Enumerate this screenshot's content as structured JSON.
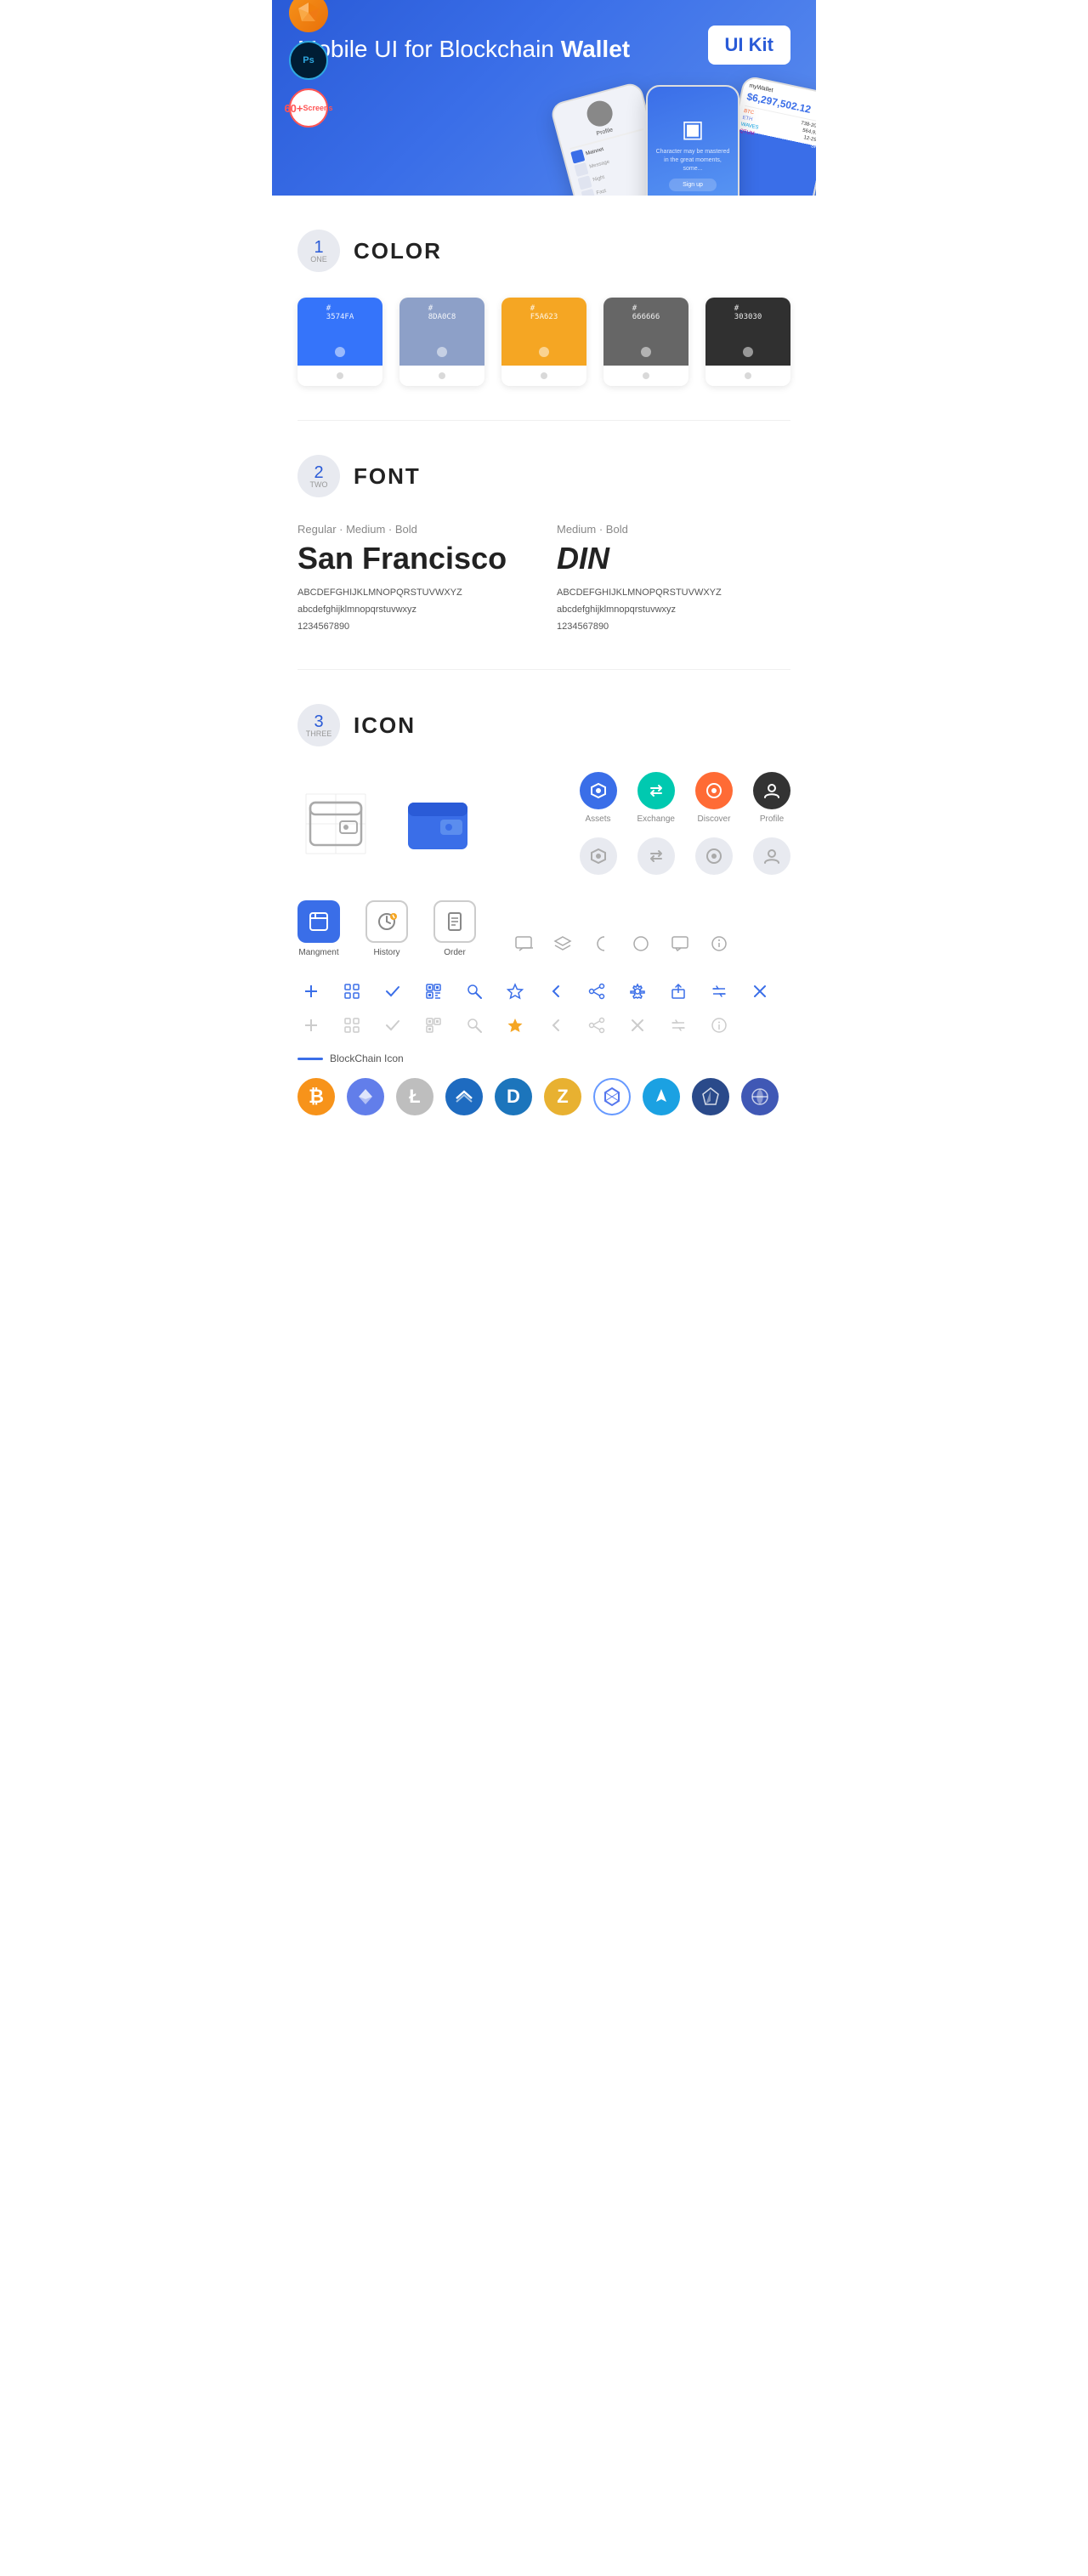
{
  "hero": {
    "title_plain": "Mobile UI for Blockchain ",
    "title_bold": "Wallet",
    "badge": "UI Kit",
    "tool_sketch": "S",
    "tool_ps": "Ps",
    "screens_count": "60+",
    "screens_label": "Screens"
  },
  "sections": {
    "color": {
      "number": "1",
      "word": "ONE",
      "title": "COLOR",
      "swatches": [
        {
          "hex": "#3574FA",
          "label": "#\n3574FA",
          "bg": "#3574FA"
        },
        {
          "hex": "#8DA0C8",
          "label": "#\n8DA0C8",
          "bg": "#8DA0C8"
        },
        {
          "hex": "#F5A623",
          "label": "#\nF5A623",
          "bg": "#F5A623"
        },
        {
          "hex": "#666666",
          "label": "#\n666666",
          "bg": "#666666"
        },
        {
          "hex": "#303030",
          "label": "#\n303030",
          "bg": "#303030"
        }
      ]
    },
    "font": {
      "number": "2",
      "word": "TWO",
      "title": "FONT",
      "font1": {
        "style": "Regular · Medium · Bold",
        "name": "San Francisco",
        "upper": "ABCDEFGHIJKLMNOPQRSTUVWXYZ",
        "lower": "abcdefghijklmnopqrstuvwxyz",
        "nums": "1234567890"
      },
      "font2": {
        "style": "Medium · Bold",
        "name": "DIN",
        "upper": "ABCDEFGHIJKLMNOPQRSTUVWXYZ",
        "lower": "abcdefghijklmnopqrstuvwxyz",
        "nums": "1234567890"
      }
    },
    "icon": {
      "number": "3",
      "word": "THREE",
      "title": "ICON",
      "nav_items": [
        {
          "label": "Assets",
          "color": "blue",
          "symbol": "◈"
        },
        {
          "label": "Exchange",
          "color": "cyan",
          "symbol": "⇄"
        },
        {
          "label": "Discover",
          "color": "orange",
          "symbol": "◉"
        },
        {
          "label": "Profile",
          "color": "dark",
          "symbol": "⌒"
        }
      ],
      "mgmt_items": [
        {
          "label": "Mangment",
          "style": "blue",
          "symbol": "▣"
        },
        {
          "label": "History",
          "style": "outline",
          "symbol": "⏱"
        },
        {
          "label": "Order",
          "style": "outline",
          "symbol": "≡"
        }
      ],
      "misc_icons_active": [
        "+",
        "⊞",
        "✓",
        "⊠",
        "⌕",
        "☆",
        "‹",
        "⟨",
        "⚙",
        "⬒",
        "⇄",
        "×"
      ],
      "misc_icons_gray": [
        "+",
        "⊞",
        "✓",
        "⊠",
        "⌕",
        "☆",
        "‹",
        "⟨",
        "⚙",
        "⬒",
        "⇄",
        "×"
      ],
      "blockchain_label": "BlockChain Icon",
      "crypto": [
        {
          "symbol": "₿",
          "class": "crypto-btc",
          "name": "Bitcoin"
        },
        {
          "symbol": "Ξ",
          "class": "crypto-eth",
          "name": "Ethereum"
        },
        {
          "symbol": "Ł",
          "class": "crypto-ltc",
          "name": "Litecoin"
        },
        {
          "symbol": "W",
          "class": "crypto-waves",
          "name": "Waves"
        },
        {
          "symbol": "D",
          "class": "crypto-dash",
          "name": "Dash"
        },
        {
          "symbol": "Z",
          "class": "crypto-zcash",
          "name": "Zcash"
        },
        {
          "symbol": "⬡",
          "class": "crypto-grid",
          "name": "Grid"
        },
        {
          "symbol": "S",
          "class": "crypto-strat",
          "name": "Stratis"
        },
        {
          "symbol": "▲",
          "class": "crypto-ardr",
          "name": "Ardor"
        },
        {
          "symbol": "P",
          "class": "crypto-poly",
          "name": "Polymath"
        }
      ]
    }
  }
}
